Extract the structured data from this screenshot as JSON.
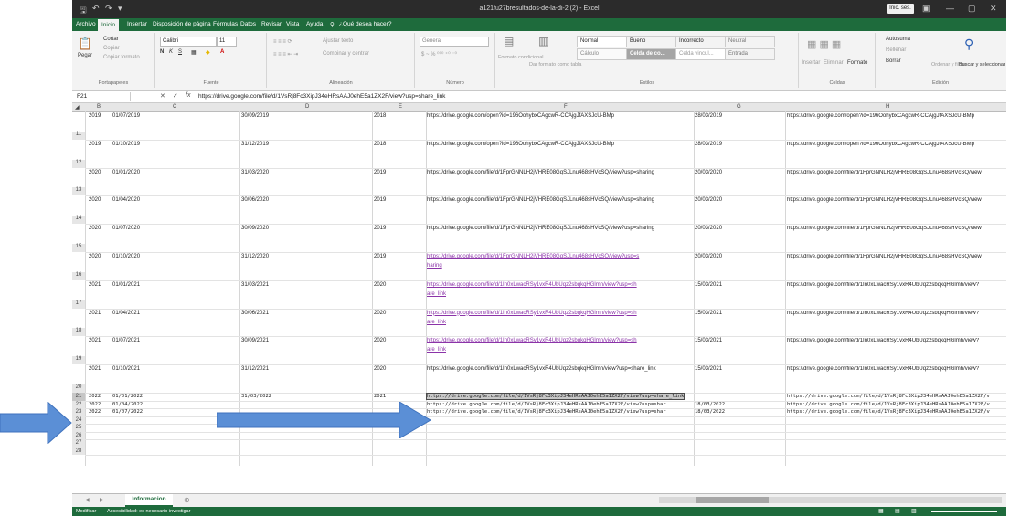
{
  "window": {
    "title": "a121fu27bresultados-de-la-di-2 (2) - Excel",
    "session_button": "Inic. ses."
  },
  "menu": [
    "Archivo",
    "Inicio",
    "Insertar",
    "Disposición de página",
    "Fórmulas",
    "Datos",
    "Revisar",
    "Vista",
    "Ayuda",
    "¿Qué desea hacer?"
  ],
  "ribbon": {
    "clipboard": {
      "paste": "Pegar",
      "cut": "Cortar",
      "copy": "Copiar",
      "format_painter": "Copiar formato",
      "label": "Portapapeles"
    },
    "font": {
      "name": "Calibri",
      "size": "11",
      "label": "Fuente"
    },
    "alignment": {
      "wrap": "Ajustar texto",
      "merge": "Combinar y centrar",
      "label": "Alineación"
    },
    "number": {
      "format": "General",
      "label": "Número"
    },
    "styles": {
      "conditional": "Formato condicional",
      "table": "Dar formato como tabla",
      "cells": [
        "Normal",
        "Bueno",
        "Incorrecto",
        "Neutral",
        "Cálculo",
        "Celda de co...",
        "Celda vincul...",
        "Entrada"
      ],
      "label": "Estilos"
    },
    "cells_grp": {
      "insert": "Insertar",
      "delete": "Eliminar",
      "format": "Formato",
      "label": "Celdas"
    },
    "editing": {
      "autosum": "Autosuma",
      "fill": "Rellenar",
      "clear": "Borrar",
      "sort": "Ordenar y filtrar",
      "find": "Buscar y seleccionar",
      "label": "Edición"
    }
  },
  "formula_bar": {
    "name_box": "F21",
    "value": "https://drive.google.com/file/d/1VsRj8Fc3XipJ34eHRsAAJ0ehE5a1ZX2F/view?usp=share_link"
  },
  "columns": [
    "B",
    "C",
    "D",
    "E",
    "F",
    "G",
    "H"
  ],
  "rows": [
    {
      "n": "11",
      "b": "2019",
      "c": "01/07/2019",
      "d": "30/09/2019",
      "e": "2018",
      "f": "https://drive.google.com/open?id=196OohybxCAgcwR-CCAjgJfAXSJcU-BMp",
      "link": false,
      "g": "28/03/2019",
      "h": "https://drive.google.com/open?id=196OohybxCAgcwR-CCAjgJfAXSJcU-BMp"
    },
    {
      "n": "12",
      "b": "2019",
      "c": "01/10/2019",
      "d": "31/12/2019",
      "e": "2018",
      "f": "https://drive.google.com/open?id=196OohybxCAgcwR-CCAjgJfAXSJcU-BMp",
      "link": false,
      "g": "28/03/2019",
      "h": "https://drive.google.com/open?id=196OohybxCAgcwR-CCAjgJfAXSJcU-BMp"
    },
    {
      "n": "13",
      "b": "2020",
      "c": "01/01/2020",
      "d": "31/03/2020",
      "e": "2019",
      "f": "https://drive.google.com/file/d/1FprGNNLH2jVHRE08GqSJLnu468sHVcSQ/view?usp=sharing",
      "link": false,
      "g": "20/03/2020",
      "h": "https://drive.google.com/file/d/1FprGNNLH2jVHRE08GqSJLnu468sHVcSQ/view"
    },
    {
      "n": "14",
      "b": "2020",
      "c": "01/04/2020",
      "d": "30/06/2020",
      "e": "2019",
      "f": "https://drive.google.com/file/d/1FprGNNLH2jVHRE08GqSJLnu468sHVcSQ/view?usp=sharing",
      "link": false,
      "g": "20/03/2020",
      "h": "https://drive.google.com/file/d/1FprGNNLH2jVHRE08GqSJLnu468sHVcSQ/view"
    },
    {
      "n": "15",
      "b": "2020",
      "c": "01/07/2020",
      "d": "30/09/2020",
      "e": "2019",
      "f": "https://drive.google.com/file/d/1FprGNNLH2jVHRE08GqSJLnu468sHVcSQ/view?usp=sharing",
      "link": false,
      "g": "20/03/2020",
      "h": "https://drive.google.com/file/d/1FprGNNLH2jVHRE08GqSJLnu468sHVcSQ/view"
    },
    {
      "n": "16",
      "b": "2020",
      "c": "01/10/2020",
      "d": "31/12/2020",
      "e": "2019",
      "f": "https://drive.google.com/file/d/1FprGNNLH2jVHRE08GqSJLnu468sHVcSQ/view?usp=s",
      "f2": "haring",
      "link": true,
      "g": "20/03/2020",
      "h": "https://drive.google.com/file/d/1FprGNNLH2jVHRE08GqSJLnu468sHVcSQ/view"
    },
    {
      "n": "17",
      "b": "2021",
      "c": "01/01/2021",
      "d": "31/03/2021",
      "e": "2020",
      "f": "https://drive.google.com/file/d/1In0xLwacRSy1vxR4UbUqz2sbqkqHGlmh/view?usp=sh",
      "f2": "are_link",
      "link": true,
      "g": "15/03/2021",
      "h": "https://drive.google.com/file/d/1In0xLwacRSy1vxR4UbUqz2sbqkqHGlmh/view?"
    },
    {
      "n": "18",
      "b": "2021",
      "c": "01/04/2021",
      "d": "30/06/2021",
      "e": "2020",
      "f": "https://drive.google.com/file/d/1In0xLwacRSy1vxR4UbUqz2sbqkqHGlmh/view?usp=sh",
      "f2": "are_link",
      "link": true,
      "g": "15/03/2021",
      "h": "https://drive.google.com/file/d/1In0xLwacRSy1vxR4UbUqz2sbqkqHGlmh/view?"
    },
    {
      "n": "19",
      "b": "2021",
      "c": "01/07/2021",
      "d": "30/09/2021",
      "e": "2020",
      "f": "https://drive.google.com/file/d/1In0xLwacRSy1vxR4UbUqz2sbqkqHGlmh/view?usp=sh",
      "f2": "are_link",
      "link": true,
      "g": "15/03/2021",
      "h": "https://drive.google.com/file/d/1In0xLwacRSy1vxR4UbUqz2sbqkqHGlmh/view?"
    },
    {
      "n": "20",
      "b": "2021",
      "c": "01/10/2021",
      "d": "31/12/2021",
      "e": "2020",
      "f": "https://drive.google.com/file/d/1In0xLwacRSy1vxR4UbUqz2sbqkqHGlmh/view?usp=share_link",
      "link": false,
      "g": "15/03/2021",
      "h": "https://drive.google.com/file/d/1In0xLwacRSy1vxR4UbUqz2sbqkqHGlmh/view?"
    }
  ],
  "small_rows": [
    {
      "n": "21",
      "b": "2022",
      "c": "01/01/2022",
      "d": "31/03/2022",
      "e": "2021",
      "f": "https://drive.google.com/file/d/1VsRj8Fc3XipJ34eHRsAAJ0ehE5a1ZX2F/view?usp=share_link",
      "g": "",
      "h": "https://drive.google.com/file/d/1VsRj8Fc3XipJ34eHRsAAJ0ehE5a1ZX2F/v"
    },
    {
      "n": "22",
      "b": "2022",
      "c": "01/04/2022",
      "d": "",
      "e": "",
      "f": "https://drive.google.com/file/d/1VsRj8Fc3XipJ34eHRsAAJ0ehE5a1ZX2F/view?usp=shar",
      "g": "18/03/2022",
      "h": "https://drive.google.com/file/d/1VsRj8Fc3XipJ34eHRsAAJ0ehE5a1ZX2F/v"
    },
    {
      "n": "23",
      "b": "2022",
      "c": "01/07/2022",
      "d": "",
      "e": "",
      "f": "https://drive.google.com/file/d/1VsRj8Fc3XipJ34eHRsAAJ0ehE5a1ZX2F/view?usp=shar",
      "g": "18/03/2022",
      "h": "https://drive.google.com/file/d/1VsRj8Fc3XipJ34eHRsAAJ0ehE5a1ZX2F/v"
    }
  ],
  "empty_rows": [
    "24",
    "25",
    "26",
    "27",
    "28"
  ],
  "sheet": {
    "tab": "Informacion"
  },
  "status": {
    "mode": "Modificar",
    "accessibility": "Accesibilidad: es necesario investigar"
  },
  "colors": {
    "excel_green": "#1e6b3c",
    "link": "#8b33a8",
    "arrow_blue": "#5b8fd6"
  }
}
